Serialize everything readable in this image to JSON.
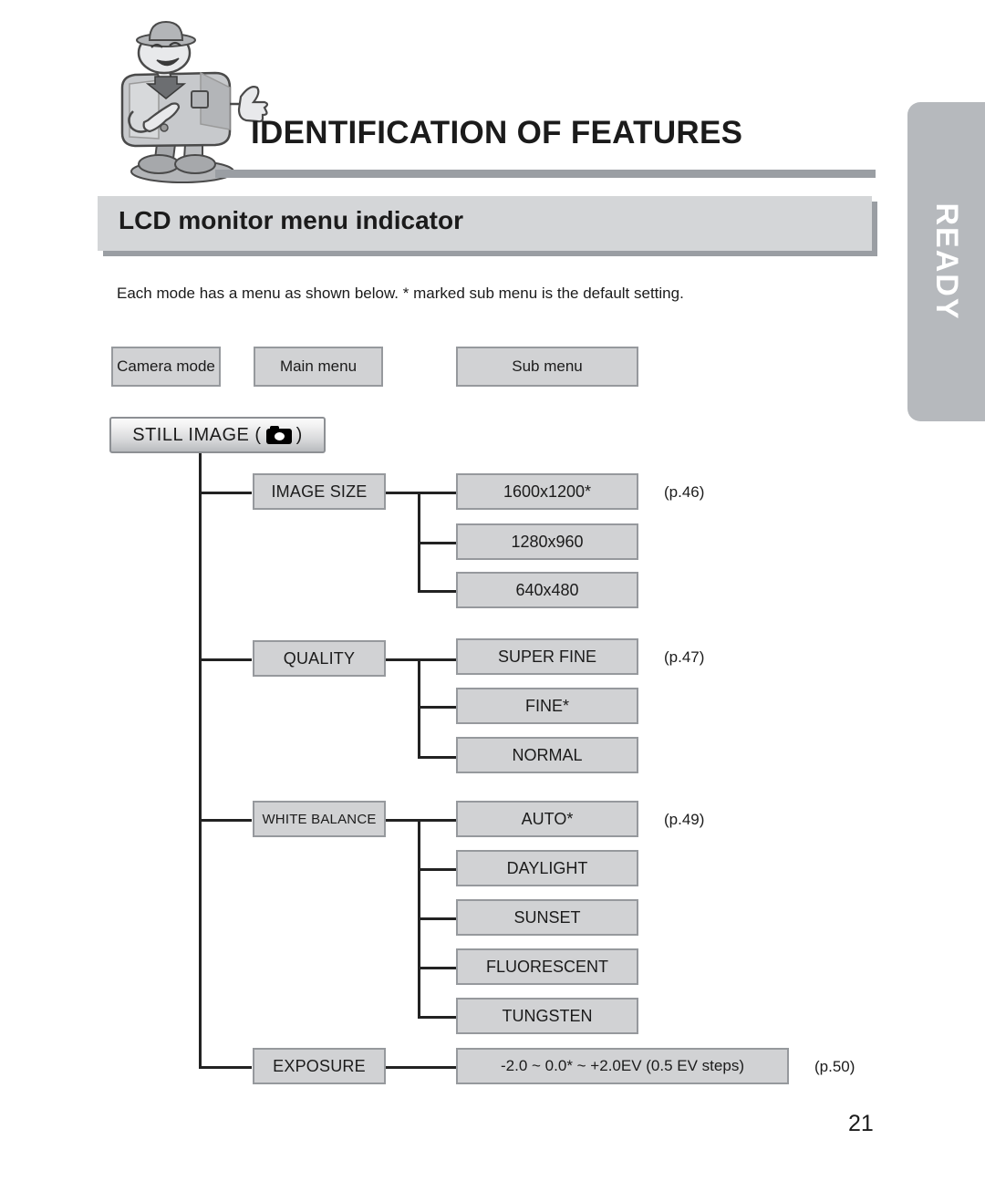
{
  "header": {
    "title": "IDENTIFICATION OF FEATURES",
    "section_title": "LCD monitor menu indicator",
    "side_tab_label": "READY",
    "mascot_icon": "camera-mascot-icon"
  },
  "intro": {
    "text": "Each mode has a menu as shown below. * marked sub menu is the default setting."
  },
  "legend": {
    "camera_mode": "Camera mode",
    "main_menu": "Main menu",
    "sub_menu": "Sub menu"
  },
  "mode": {
    "label_prefix": "STILL IMAGE (",
    "label_suffix": ")",
    "icon": "camera-icon"
  },
  "menus": [
    {
      "label": "IMAGE SIZE",
      "page_ref": "(p.46)",
      "items": [
        "1600x1200*",
        "1280x960",
        "640x480"
      ]
    },
    {
      "label": "QUALITY",
      "page_ref": "(p.47)",
      "items": [
        "SUPER FINE",
        "FINE*",
        "NORMAL"
      ]
    },
    {
      "label": "WHITE BALANCE",
      "page_ref": "(p.49)",
      "items": [
        "AUTO*",
        "DAYLIGHT",
        "SUNSET",
        "FLUORESCENT",
        "TUNGSTEN"
      ]
    },
    {
      "label": "EXPOSURE",
      "page_ref": "(p.50)",
      "items": [
        "-2.0 ~ 0.0* ~ +2.0EV (0.5 EV steps)"
      ]
    }
  ],
  "footer": {
    "page_number": "21"
  },
  "colors": {
    "box_fill": "#d1d2d4",
    "box_border": "#96999d",
    "bar_fill": "#d4d6d8",
    "bar_shadow": "#9a9ea3",
    "tab_fill": "#b6b9bd",
    "line": "#222222"
  }
}
